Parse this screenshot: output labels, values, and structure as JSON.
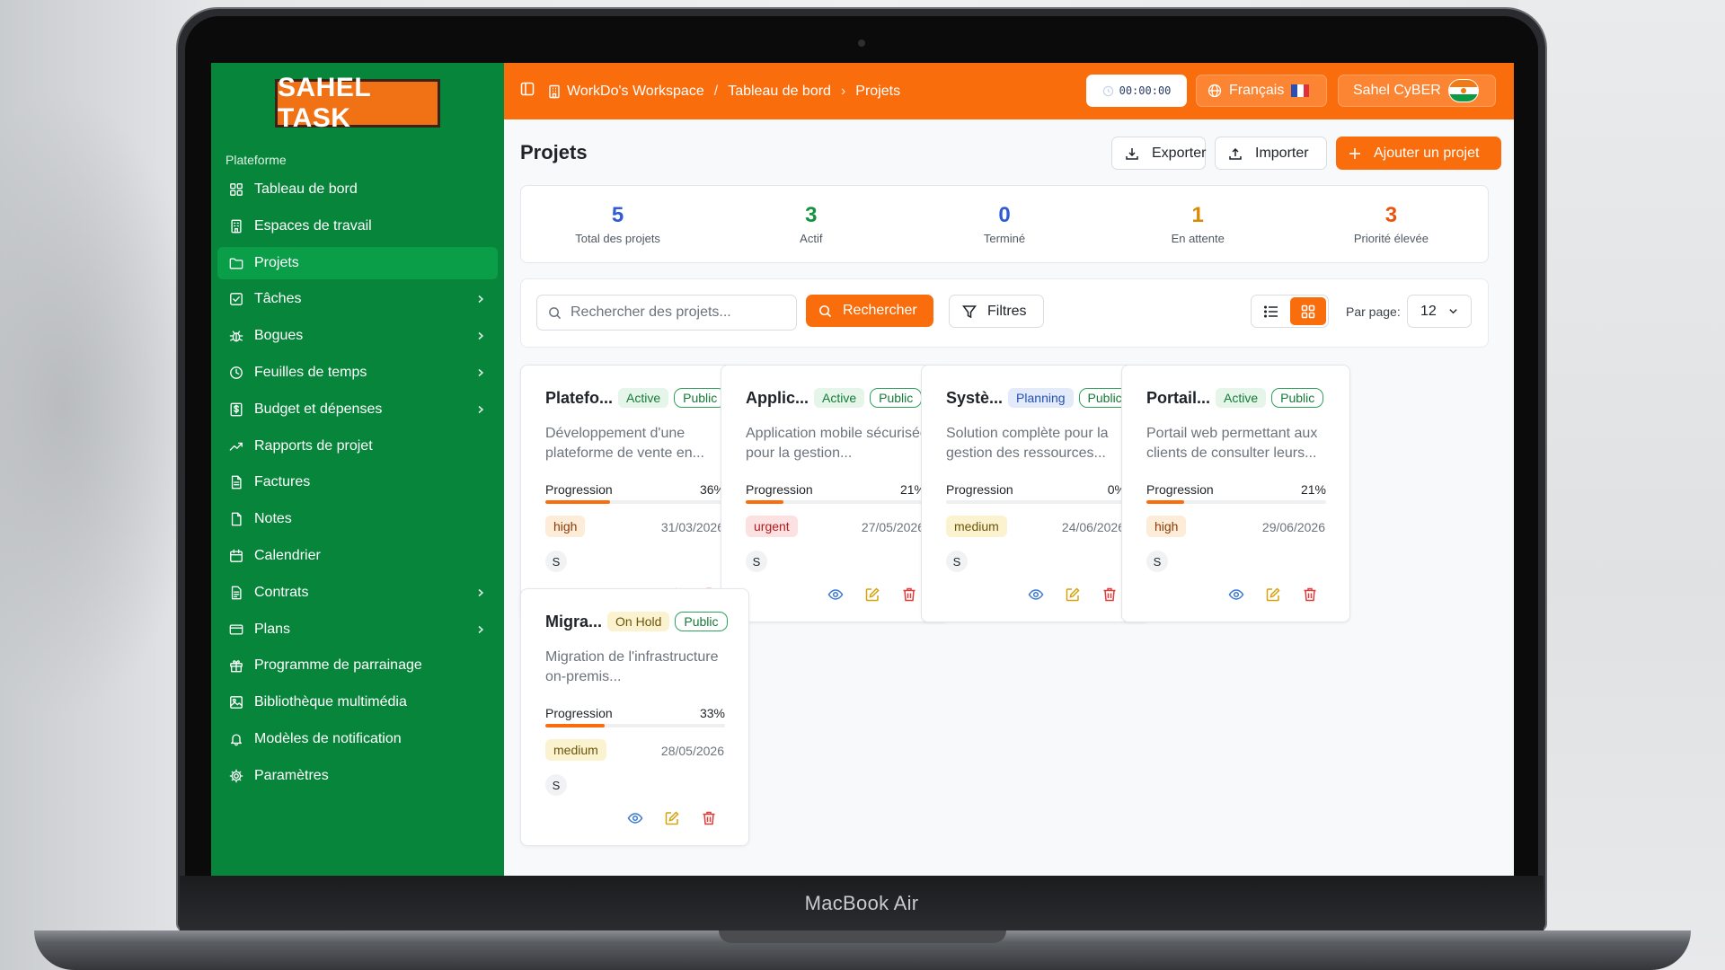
{
  "device": {
    "label": "MacBook Air"
  },
  "app": {
    "logo": "SAHEL TASK",
    "sidebar": {
      "section": "Plateforme",
      "items": [
        {
          "label": "Tableau de bord",
          "icon": "dashboard-icon"
        },
        {
          "label": "Espaces de travail",
          "icon": "building-icon"
        },
        {
          "label": "Projets",
          "icon": "folder-icon",
          "active": true
        },
        {
          "label": "Tâches",
          "icon": "checkbox-icon",
          "submenu": true
        },
        {
          "label": "Bogues",
          "icon": "bug-icon",
          "submenu": true
        },
        {
          "label": "Feuilles de temps",
          "icon": "clock-icon",
          "submenu": true
        },
        {
          "label": "Budget et dépenses",
          "icon": "dollar-icon",
          "submenu": true
        },
        {
          "label": "Rapports de projet",
          "icon": "trend-icon"
        },
        {
          "label": "Factures",
          "icon": "invoice-icon"
        },
        {
          "label": "Notes",
          "icon": "file-icon"
        },
        {
          "label": "Calendrier",
          "icon": "calendar-icon"
        },
        {
          "label": "Contrats",
          "icon": "contract-icon",
          "submenu": true
        },
        {
          "label": "Plans",
          "icon": "card-icon",
          "submenu": true
        },
        {
          "label": "Programme de parrainage",
          "icon": "gift-icon"
        },
        {
          "label": "Bibliothèque multimédia",
          "icon": "image-icon"
        },
        {
          "label": "Modèles de notification",
          "icon": "bell-icon"
        },
        {
          "label": "Paramètres",
          "icon": "gear-icon"
        }
      ]
    },
    "topbar": {
      "breadcrumb": [
        "WorkDo's Workspace",
        "Tableau de bord",
        "Projets"
      ],
      "separators": [
        "/",
        "›"
      ],
      "timer": "00:00:00",
      "language": "Français",
      "user": "Sahel CyBER"
    },
    "page": {
      "title": "Projets",
      "buttons": {
        "export": "Exporter",
        "import": "Importer",
        "add": "Ajouter un projet"
      },
      "stats": [
        {
          "value": "5",
          "label": "Total des projets",
          "color": "#2f5bd3"
        },
        {
          "value": "3",
          "label": "Actif",
          "color": "#13923f"
        },
        {
          "value": "0",
          "label": "Terminé",
          "color": "#2f5bd3"
        },
        {
          "value": "1",
          "label": "En attente",
          "color": "#d98b06"
        },
        {
          "value": "3",
          "label": "Priorité élevée",
          "color": "#e8550f"
        }
      ],
      "filters": {
        "search_placeholder": "Rechercher des projets...",
        "search_button": "Rechercher",
        "filters_button": "Filtres",
        "per_page_label": "Par page:",
        "per_page_value": "12"
      },
      "progress_label": "Progression",
      "projects": [
        {
          "title": "Platefo...",
          "status": "Active",
          "status_class": "active",
          "visibility": "Public",
          "description": "Développement d'une plateforme de vente en...",
          "progress": 36,
          "progress_text": "36%",
          "priority": "high",
          "due": "31/03/2026",
          "member": "S"
        },
        {
          "title": "Applic...",
          "status": "Active",
          "status_class": "active",
          "visibility": "Public",
          "description": "Application mobile sécurisée pour la gestion...",
          "progress": 21,
          "progress_text": "21%",
          "priority": "urgent",
          "due": "27/05/2026",
          "member": "S"
        },
        {
          "title": "Systè...",
          "status": "Planning",
          "status_class": "planning",
          "visibility": "Public",
          "description": "Solution complète pour la gestion des ressources...",
          "progress": 0,
          "progress_text": "0%",
          "priority": "medium",
          "due": "24/06/2026",
          "member": "S"
        },
        {
          "title": "Portail...",
          "status": "Active",
          "status_class": "active",
          "visibility": "Public",
          "description": "Portail web permettant aux clients de consulter leurs...",
          "progress": 21,
          "progress_text": "21%",
          "priority": "high",
          "due": "29/06/2026",
          "member": "S"
        },
        {
          "title": "Migra...",
          "status": "On Hold",
          "status_class": "onhold",
          "visibility": "Public",
          "description": "Migration de l'infrastructure on-premis...",
          "progress": 33,
          "progress_text": "33%",
          "priority": "medium",
          "due": "28/05/2026",
          "member": "S"
        }
      ]
    }
  }
}
